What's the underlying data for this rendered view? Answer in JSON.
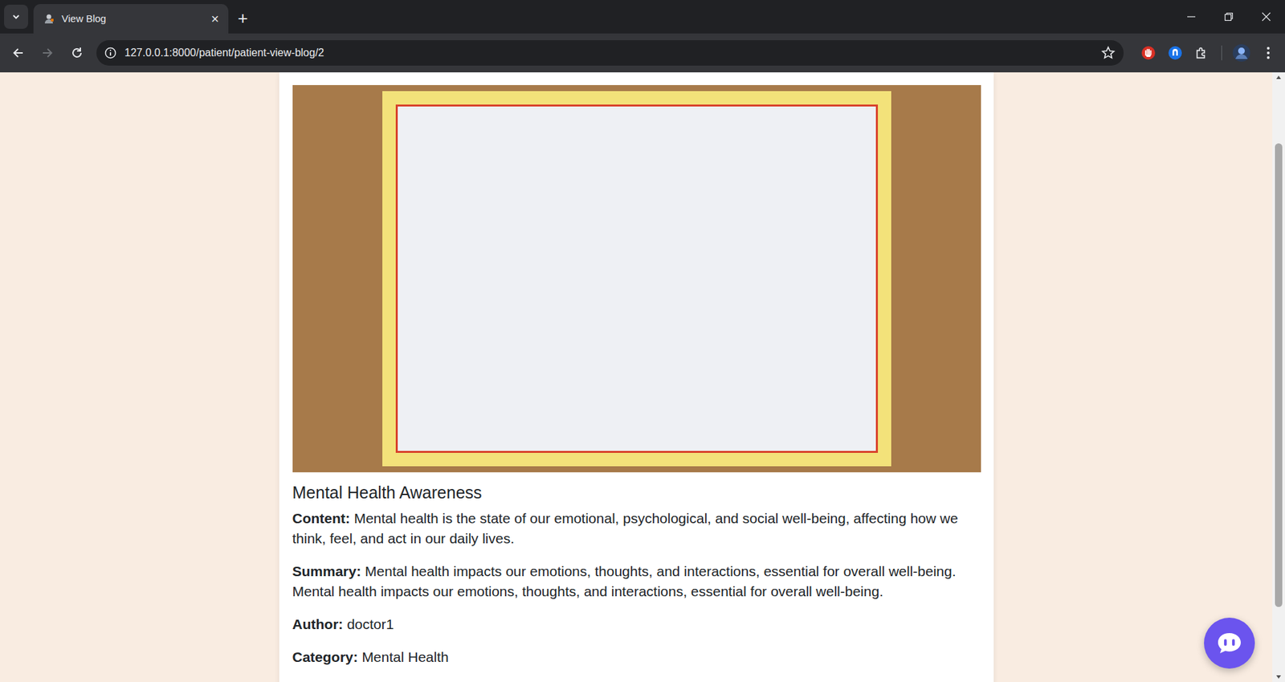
{
  "tabs": [
    {
      "label": "View Blog",
      "selected": true,
      "close": "×"
    }
  ],
  "new_tab": "+",
  "nav": {
    "back_enabled": true,
    "forward_enabled": false
  },
  "address": {
    "url": "127.0.0.1:8000/patient/patient-view-blog/2",
    "bookmarked": false
  },
  "blog": {
    "title": "Mental Health Awareness",
    "fields": [
      {
        "label": "Content:",
        "value": "Mental health is the state of our emotional, psychological, and social well-being, affecting how we think, feel, and act in our daily lives."
      },
      {
        "label": "Summary:",
        "value": "Mental health impacts our emotions, thoughts, and interactions, essential for overall well-being. Mental health impacts our emotions, thoughts, and interactions, essential for overall well-being."
      },
      {
        "label": "Author:",
        "value": "doctor1"
      },
      {
        "label": "Category:",
        "value": "Mental Health"
      }
    ]
  }
}
